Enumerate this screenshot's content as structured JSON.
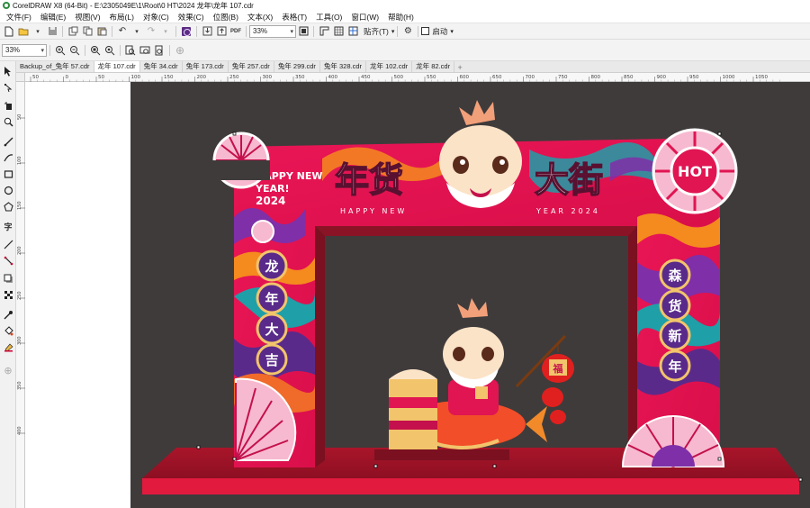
{
  "window": {
    "title": "CorelDRAW X8 (64-Bit) - E:\\2305049E\\1\\Root\\0 HT\\2024 龙年\\龙年 107.cdr"
  },
  "menu": [
    "文件(F)",
    "编辑(E)",
    "视图(V)",
    "布局(L)",
    "对象(C)",
    "效果(C)",
    "位图(B)",
    "文本(X)",
    "表格(T)",
    "工具(O)",
    "窗口(W)",
    "帮助(H)"
  ],
  "toolbar": {
    "zoom_value": "33%",
    "snap_label": "贴齐(T)",
    "launch_label": "启动"
  },
  "propbar": {
    "zoom_value": "33%"
  },
  "tabs": [
    "Backup_of_兔年 57.cdr",
    "龙年 107.cdr",
    "兔年 34.cdr",
    "兔年 173.cdr",
    "兔年 257.cdr",
    "兔年 299.cdr",
    "兔年 328.cdr",
    "龙年 102.cdr",
    "龙年 82.cdr"
  ],
  "active_tab": "龙年 107.cdr",
  "ruler": {
    "h_ticks": [
      "50",
      "0",
      "50",
      "100",
      "150",
      "200",
      "250",
      "300",
      "350",
      "400",
      "450",
      "500",
      "550",
      "600",
      "650",
      "700",
      "750",
      "800",
      "850",
      "900",
      "950",
      "1000",
      "1050"
    ],
    "v_ticks": [
      "50",
      "100",
      "150",
      "200",
      "250",
      "300",
      "350",
      "400"
    ]
  },
  "artwork": {
    "title_left": "年货",
    "title_right": "大街",
    "sub_left": "HAPPY NEW",
    "sub_right": "YEAR 2024",
    "happy_line1": "HAPPY NEW",
    "happy_line2": "YEAR!",
    "happy_line3": "2024",
    "hot_badge": "HOT",
    "left_circles": [
      "龙",
      "年",
      "大",
      "吉"
    ],
    "right_circles": [
      "森",
      "货",
      "新",
      "年"
    ],
    "lantern_char": "福",
    "colors": {
      "canvas_dark": "#3f3b3b",
      "arch_red": "#e01552",
      "arch_dark": "#7a1020",
      "purple": "#5a2a8a",
      "floor": "#c9172c",
      "gold": "#f2c46b"
    }
  }
}
